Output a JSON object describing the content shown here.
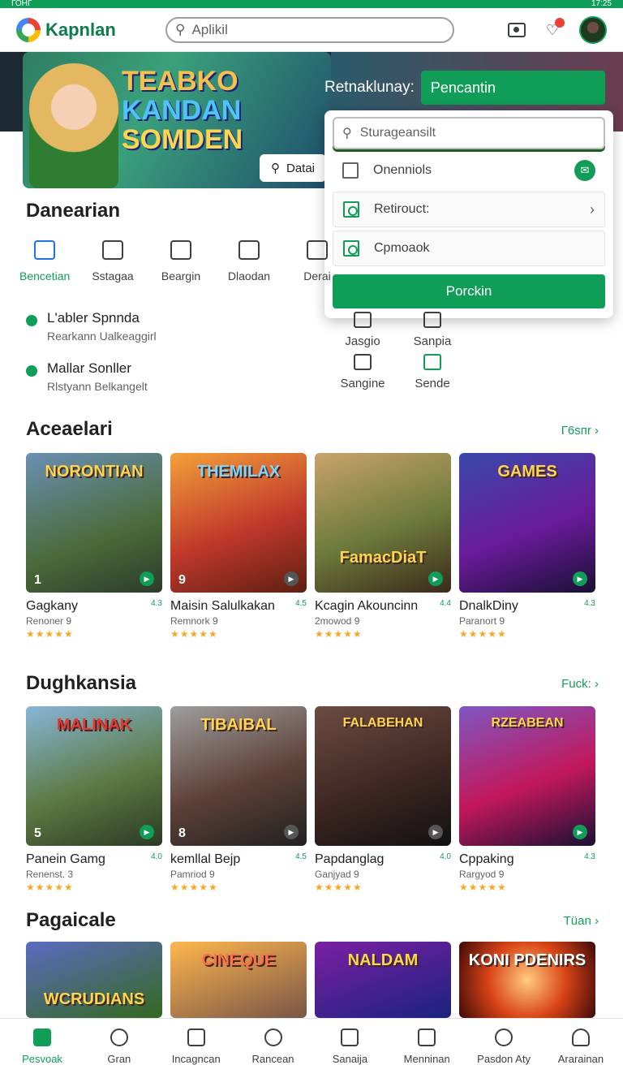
{
  "statusbar": {
    "left": "ГОНГ",
    "right": "17:25"
  },
  "app": {
    "name": "Kapnlan"
  },
  "search": {
    "placeholder": "Aplikil"
  },
  "hero": {
    "title_lines": [
      "TEABKO",
      "KANDAN",
      "SOMDEN"
    ],
    "button_label": "Datai"
  },
  "promo": {
    "label": "Retnaklunay:",
    "button": "Pencantin"
  },
  "popup": {
    "search_placeholder": "Sturageansilt",
    "options": [
      "Onenniols",
      "Retirouct:",
      "Cpmoaok"
    ],
    "confirm_label": "Porckin"
  },
  "section1": {
    "title": "Danearian",
    "categories": [
      "Bencetian",
      "Sstagaa",
      "Beargin",
      "Dlaodan",
      "Derai"
    ],
    "list": [
      {
        "title": "L'abler Spnnda",
        "subtitle": "Rearkann Ualkeaggirl"
      },
      {
        "title": "Mallar Sonller",
        "subtitle": "Rlstyann Belkangelt"
      }
    ],
    "side_items": [
      "Jasgio",
      "Sanpia",
      "Sangine",
      "Sende"
    ]
  },
  "section2": {
    "title": "Aceaelari",
    "see_all": "Г6sпr",
    "cards": [
      {
        "thumb": "NORONTIAN",
        "rank": "1",
        "name": "Gagkany",
        "sub": "Renoner 9",
        "rating": "4.3"
      },
      {
        "thumb": "THEMILAX",
        "rank": "9",
        "name": "Maisin Salulkakan",
        "sub": "Remnork 9",
        "rating": "4.5"
      },
      {
        "thumb": "FamacDiaT",
        "rank": "",
        "name": "Kcagin Akouncinn",
        "sub": "2mowod 9",
        "rating": "4.4"
      },
      {
        "thumb": "GAMES",
        "rank": "",
        "name": "DnalkDiny",
        "sub": "Paranort 9",
        "rating": "4.3"
      }
    ]
  },
  "section3": {
    "title": "Dughkansia",
    "see_all": "Fuck:",
    "cards": [
      {
        "thumb": "MALINAK",
        "rank": "5",
        "name": "Panein Gamg",
        "sub": "Renenst. 3",
        "rating": "4.0"
      },
      {
        "thumb": "TIBAIBAL",
        "rank": "8",
        "name": "kemllal Bejp",
        "sub": "Pamriod 9",
        "rating": "4.5"
      },
      {
        "thumb": "FALABEHAN",
        "rank": "",
        "name": "Papdanglag",
        "sub": "Ganjyad 9",
        "rating": "4.0"
      },
      {
        "thumb": "RZEABEAN",
        "rank": "",
        "name": "Cppaking",
        "sub": "Rargyod 9",
        "rating": "4.3"
      }
    ]
  },
  "section4": {
    "title": "Pagaicale",
    "see_all": "Tüan",
    "cards": [
      {
        "thumb": "WCRUDIANS"
      },
      {
        "thumb": "CINEQUE"
      },
      {
        "thumb": "NALDAM"
      },
      {
        "thumb": "KONI PDENIRS"
      }
    ]
  },
  "navbar": [
    "Pesvoak",
    "Gran",
    "Incagncan",
    "Rancean",
    "Sanaija",
    "Menninan",
    "Pasdon Aty",
    "Ararainan"
  ],
  "colors": {
    "brand": "#0f9d58",
    "link": "#1a73e8"
  }
}
